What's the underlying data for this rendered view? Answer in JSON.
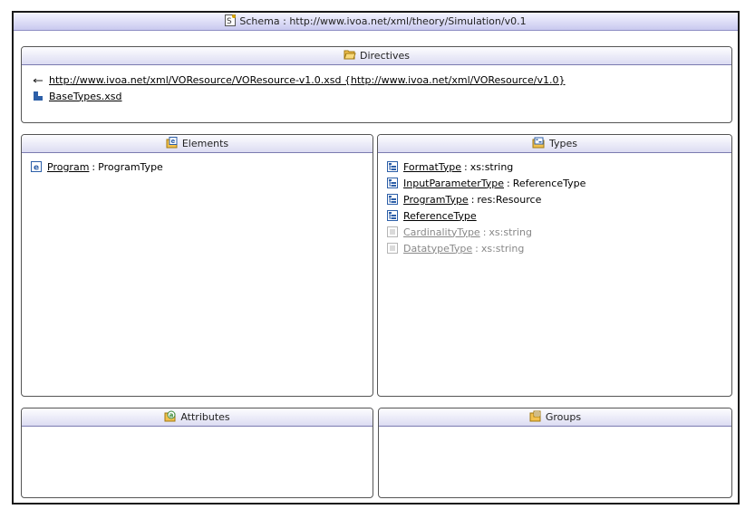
{
  "title": "Schema : http://www.ivoa.net/xml/theory/Simulation/v0.1",
  "directives": {
    "heading": "Directives",
    "items": [
      {
        "icon": "import-icon",
        "text": "http://www.ivoa.net/xml/VOResource/VOResource-v1.0.xsd  {http://www.ivoa.net/xml/VOResource/v1.0}"
      },
      {
        "icon": "include-icon",
        "text": "BaseTypes.xsd"
      }
    ]
  },
  "elements": {
    "heading": "Elements",
    "items": [
      {
        "name": "Program",
        "type": "ProgramType"
      }
    ]
  },
  "types": {
    "heading": "Types",
    "items": [
      {
        "name": "FormatType",
        "type": "xs:string",
        "kind": "complex"
      },
      {
        "name": "InputParameterType",
        "type": "ReferenceType",
        "kind": "complex"
      },
      {
        "name": "ProgramType",
        "type": "res:Resource",
        "kind": "complex"
      },
      {
        "name": "ReferenceType",
        "type": "",
        "kind": "complex"
      },
      {
        "name": "CardinalityType",
        "type": "xs:string",
        "kind": "simple"
      },
      {
        "name": "DatatypeType",
        "type": "xs:string",
        "kind": "simple"
      }
    ]
  },
  "attributes": {
    "heading": "Attributes"
  },
  "groups": {
    "heading": "Groups"
  },
  "colors": {
    "title_gradient_bottom": "#c9c9ef",
    "complex_icon": "#2d5fa8",
    "simple_icon": "#b5b5b5"
  }
}
